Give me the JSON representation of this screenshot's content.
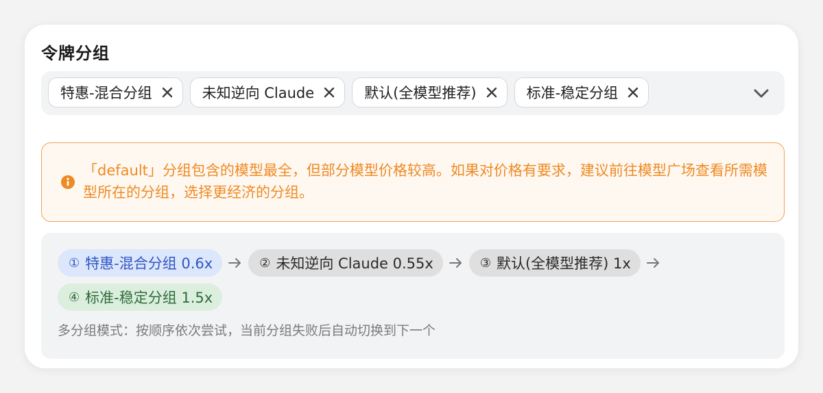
{
  "title": "令牌分组",
  "selected_groups": [
    {
      "label": "特惠-混合分组"
    },
    {
      "label": "未知逆向 Claude"
    },
    {
      "label": "默认(全模型推荐)"
    },
    {
      "label": "标准-稳定分组"
    }
  ],
  "alert": {
    "text": "「default」分组包含的模型最全，但部分模型价格较高。如果对价格有要求，建议前往模型广场查看所需模型所在的分组，选择更经济的分组。",
    "icon": "info-icon",
    "color": "#ee8a24"
  },
  "chain": [
    {
      "num": "①",
      "label": "特惠-混合分组 0.6x",
      "bg": "#dde7fb",
      "fg": "#2f56c4"
    },
    {
      "num": "②",
      "label": "未知逆向 Claude 0.55x",
      "bg": "#dfdfdf",
      "fg": "#2a2a2a"
    },
    {
      "num": "③",
      "label": "默认(全模型推荐) 1x",
      "bg": "#dfdfdf",
      "fg": "#2a2a2a"
    },
    {
      "num": "④",
      "label": "标准-稳定分组 1.5x",
      "bg": "#dcefdf",
      "fg": "#2f6b3a"
    }
  ],
  "footnote": "多分组模式：按顺序依次尝试，当前分组失败后自动切换到下一个"
}
